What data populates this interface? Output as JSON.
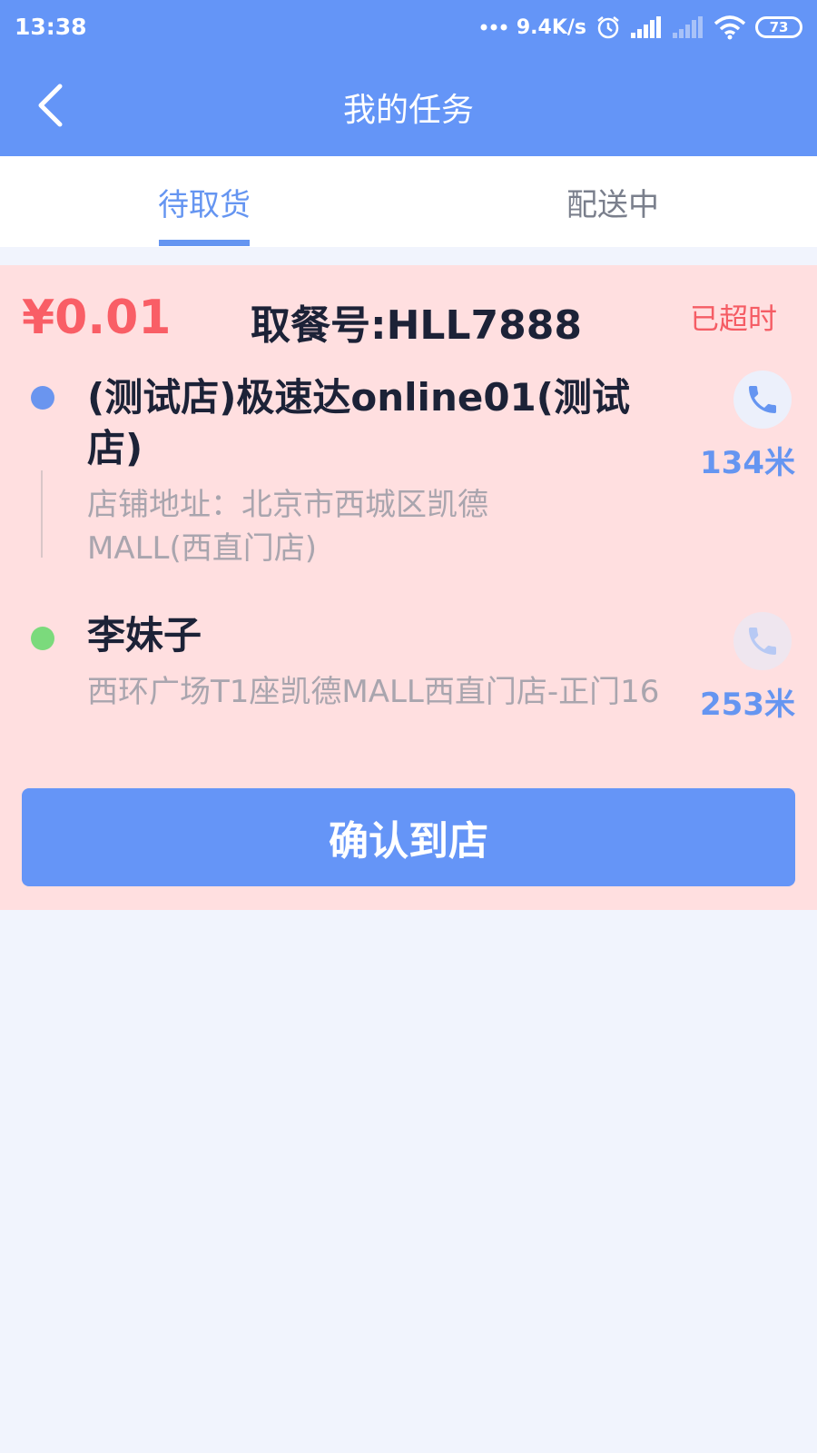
{
  "status_bar": {
    "time": "13:38",
    "network_speed": "9.4K/s",
    "battery": "73"
  },
  "header": {
    "title": "我的任务"
  },
  "tabs": [
    {
      "label": "待取货",
      "active": true
    },
    {
      "label": "配送中",
      "active": false
    }
  ],
  "order": {
    "price": "¥0.01",
    "pickup_code": "取餐号:HLL7888",
    "status": "已超时",
    "shop": {
      "name": "(测试店)极速达online01(测试店)",
      "address": "店铺地址：北京市西城区凯德MALL(西直门店)",
      "distance": "134米"
    },
    "customer": {
      "name": "李妹子",
      "address": "西环广场T1座凯德MALL西直门店-正门16",
      "distance": "253米"
    },
    "confirm_label": "确认到店"
  },
  "colors": {
    "header_bg": "#6495f7",
    "accent": "#6595f1",
    "card_bg": "#ffdfe0",
    "price": "#f95e66",
    "overdue": "#f55d65",
    "shop_dot": "#6a95ef",
    "customer_dot": "#7bda7c"
  },
  "icons": {
    "back": "chevron-left-icon",
    "call": "phone-icon",
    "alarm": "alarm-icon",
    "signal": "signal-icon",
    "wifi": "wifi-icon",
    "battery": "battery-icon"
  }
}
